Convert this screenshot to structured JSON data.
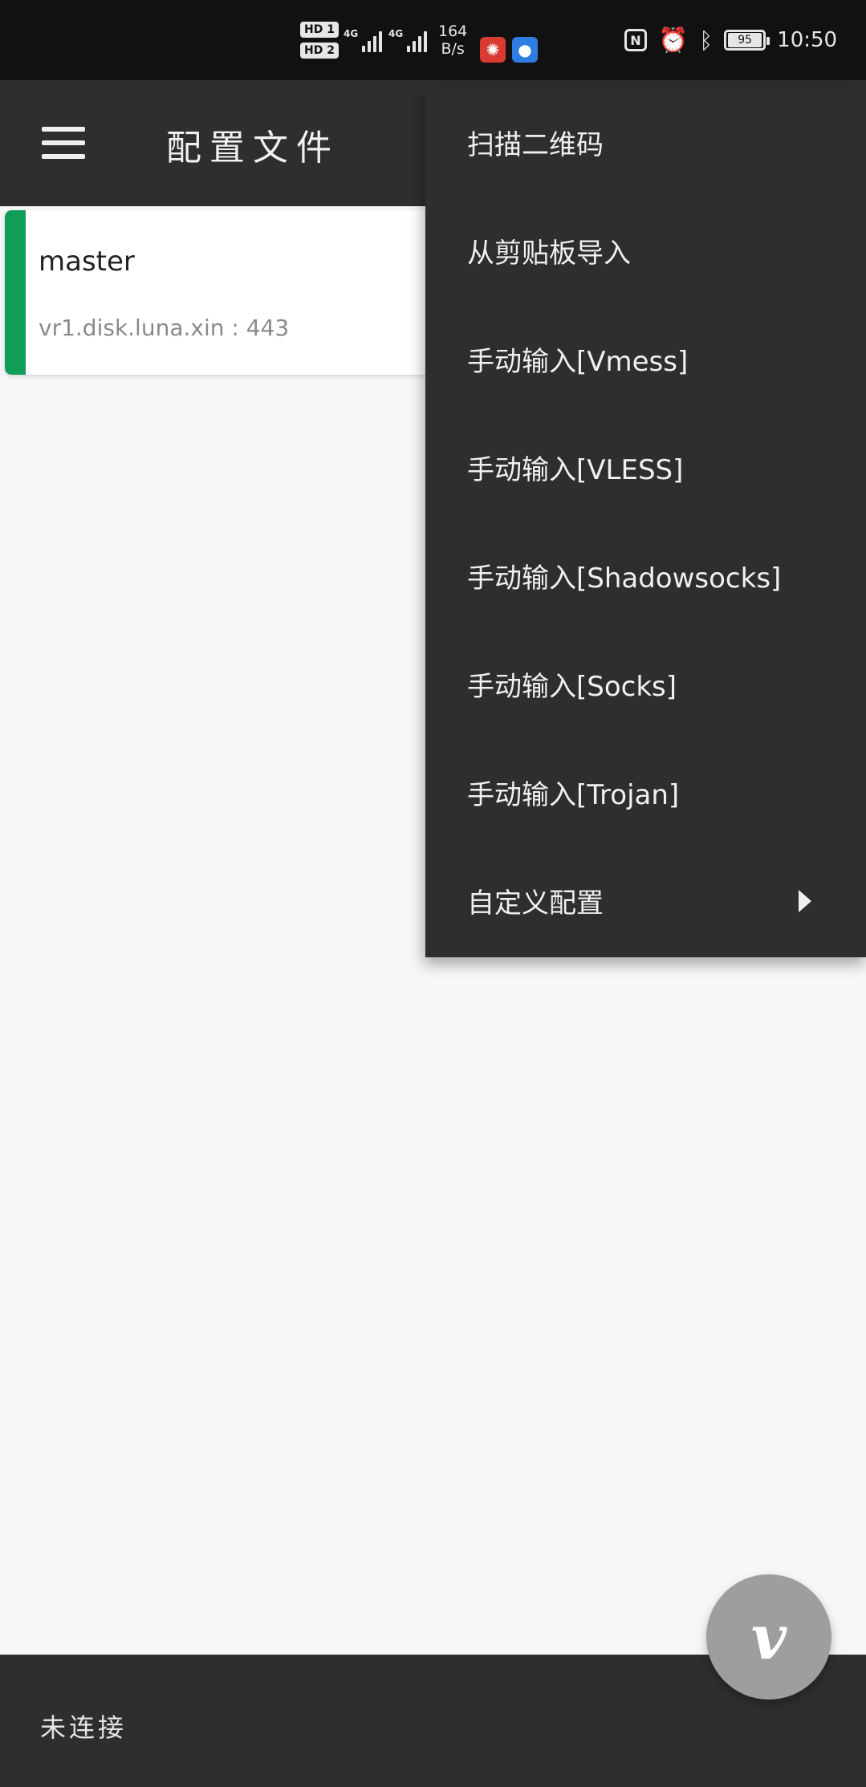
{
  "status_bar": {
    "sim1": "HD 1",
    "sim2": "HD 2",
    "network1": "4G",
    "network2": "4G",
    "net_speed_value": "164",
    "net_speed_unit": "B/s",
    "battery": "95",
    "time": "10:50",
    "icons": [
      "nfc-icon",
      "alarm-icon",
      "bluetooth-icon",
      "battery-icon"
    ]
  },
  "app_bar": {
    "title": "配置文件",
    "menu_icon": "hamburger-icon"
  },
  "servers": [
    {
      "name": "master",
      "address": "vr1.disk.luna.xin : 443",
      "accent_color": "#0f9d58"
    }
  ],
  "menu": {
    "items": [
      {
        "label": "扫描二维码"
      },
      {
        "label": "从剪贴板导入"
      },
      {
        "label": "手动输入[Vmess]"
      },
      {
        "label": "手动输入[VLESS]"
      },
      {
        "label": "手动输入[Shadowsocks]"
      },
      {
        "label": "手动输入[Socks]"
      },
      {
        "label": "手动输入[Trojan]"
      },
      {
        "label": "自定义配置",
        "has_submenu": true
      }
    ]
  },
  "fab": {
    "glyph": "v"
  },
  "bottom_bar": {
    "status": "未连接"
  },
  "colors": {
    "app_bar": "#2e2e2e",
    "menu": "#2e2e2e",
    "background": "#f7f7f7",
    "accent": "#0f9d58",
    "fab": "#9e9e9e"
  }
}
